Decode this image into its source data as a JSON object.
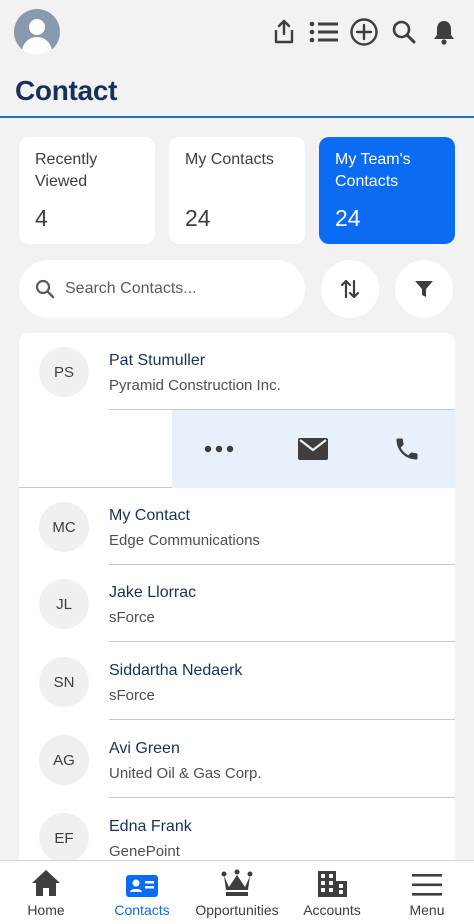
{
  "header": {
    "title": "Contact",
    "icons": [
      "share-icon",
      "list-icon",
      "add-circle-icon",
      "search-icon",
      "bell-icon"
    ]
  },
  "stats": [
    {
      "label": "Recently Viewed",
      "count": "4"
    },
    {
      "label": "My Contacts",
      "count": "24"
    },
    {
      "label": "My Team's Contacts",
      "count": "24"
    }
  ],
  "search": {
    "placeholder": "Search Contacts..."
  },
  "contacts": [
    {
      "initials": "PS",
      "name": "Pat Stumuller",
      "company": "Pyramid Construction Inc."
    },
    {
      "initials": "MC",
      "name": "My Contact",
      "company": "Edge Communications"
    },
    {
      "initials": "JL",
      "name": "Jake Llorrac",
      "company": "sForce"
    },
    {
      "initials": "SN",
      "name": "Siddartha Nedaerk",
      "company": "sForce"
    },
    {
      "initials": "AG",
      "name": "Avi Green",
      "company": "United Oil & Gas Corp."
    },
    {
      "initials": "EF",
      "name": "Edna Frank",
      "company": "GenePoint"
    }
  ],
  "row_actions": [
    "more-icon",
    "email-icon",
    "phone-icon"
  ],
  "nav": [
    {
      "label": "Home"
    },
    {
      "label": "Contacts"
    },
    {
      "label": "Opportunities"
    },
    {
      "label": "Accounts"
    },
    {
      "label": "Menu"
    }
  ],
  "colors": {
    "brand": "#0b6cf3",
    "title": "#16325c",
    "accent_rule": "#2574a9",
    "icon": "#3e3e3c"
  }
}
